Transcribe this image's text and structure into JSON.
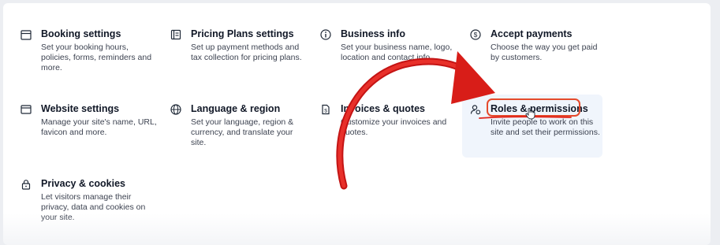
{
  "settings": [
    {
      "title": "Booking settings",
      "desc": "Set your booking hours, policies, forms, reminders and more.",
      "icon": "calendar-icon"
    },
    {
      "title": "Pricing Plans settings",
      "desc": "Set up payment methods and tax collection for pricing plans.",
      "icon": "pricing-plans-icon"
    },
    {
      "title": "Business info",
      "desc": "Set your business name, logo, location and contact info.",
      "icon": "info-icon"
    },
    {
      "title": "Accept payments",
      "desc": "Choose the way you get paid by customers.",
      "icon": "dollar-icon"
    },
    {
      "title": "Website settings",
      "desc": "Manage your site's name, URL, favicon and more.",
      "icon": "browser-icon"
    },
    {
      "title": "Language & region",
      "desc": "Set your language, region & currency, and translate your site.",
      "icon": "globe-icon"
    },
    {
      "title": "Invoices & quotes",
      "desc": "Customize your invoices and quotes.",
      "icon": "invoice-icon"
    },
    {
      "title": "Roles & permissions",
      "desc": "Invite people to work on this site and set their permissions.",
      "icon": "roles-icon"
    },
    {
      "title": "Privacy & cookies",
      "desc": "Let visitors manage their privacy, data and cookies on your site.",
      "icon": "lock-icon"
    }
  ],
  "colors": {
    "annotation_red": "#e0231a",
    "highlight_bg": "#f0f5fc"
  }
}
